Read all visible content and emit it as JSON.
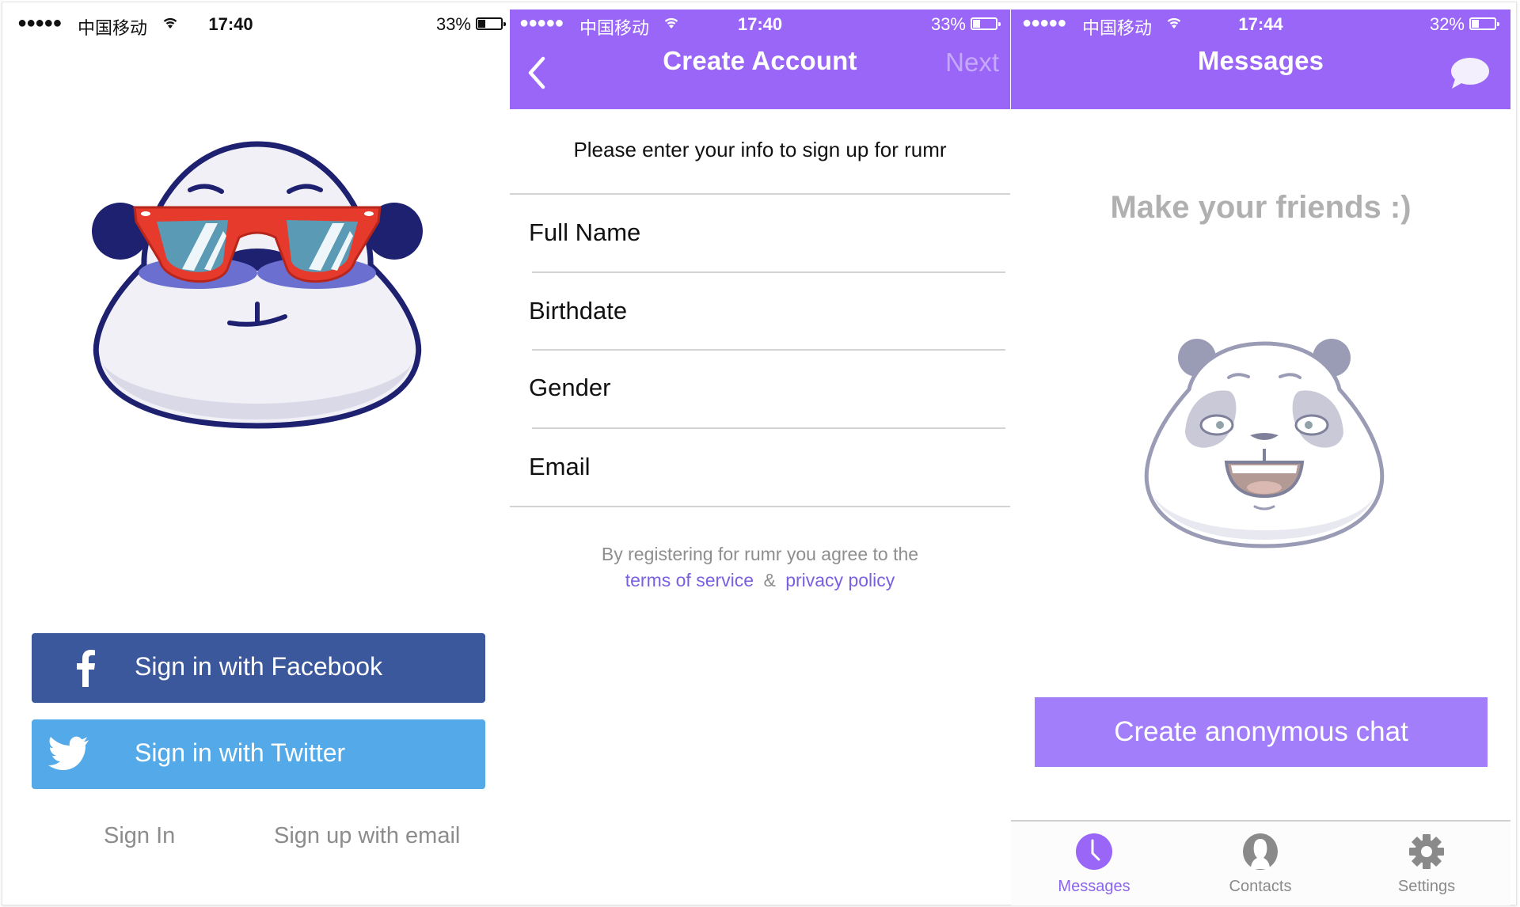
{
  "colors": {
    "brand_purple": "#9966f7",
    "button_purple": "#a27efa",
    "facebook_blue": "#3a589b",
    "twitter_blue": "#54aae9",
    "link_purple": "#7a5fe0",
    "muted_grey": "#8c8c8c"
  },
  "screens": [
    {
      "status": {
        "signal": "●●●●●",
        "carrier": "中国移动",
        "time": "17:40",
        "battery": "33%",
        "battery_level": 0.33
      },
      "buttons": {
        "facebook": {
          "label": "Sign in with Facebook",
          "icon": "facebook-icon"
        },
        "twitter": {
          "label": "Sign in with Twitter",
          "icon": "twitter-icon"
        }
      },
      "links": {
        "sign_in": "Sign In",
        "sign_up_email": "Sign up with email"
      },
      "illustration": "panda-sunglasses"
    },
    {
      "status": {
        "signal": "●●●●●",
        "carrier": "中国移动",
        "time": "17:40",
        "battery": "33%",
        "battery_level": 0.33
      },
      "nav": {
        "title": "Create Account",
        "back_icon": "chevron-left-icon",
        "next_label": "Next"
      },
      "subtitle": "Please enter your info to sign up for rumr",
      "fields": [
        {
          "label": "Full Name"
        },
        {
          "label": "Birthdate"
        },
        {
          "label": "Gender"
        },
        {
          "label": "Email"
        }
      ],
      "legal": {
        "line1": "By registering for rumr you agree to the",
        "terms": "terms of service",
        "amp": "&",
        "privacy": "privacy policy"
      }
    },
    {
      "status": {
        "signal": "●●●●●",
        "carrier": "中国移动",
        "time": "17:44",
        "battery": "32%",
        "battery_level": 0.32
      },
      "nav": {
        "title": "Messages",
        "action_icon": "chat-bubble-icon"
      },
      "empty_text": "Make your friends :)",
      "illustration": "panda-happy",
      "cta": "Create anonymous chat",
      "tabs": [
        {
          "label": "Messages",
          "icon": "clock-icon",
          "active": true
        },
        {
          "label": "Contacts",
          "icon": "person-icon",
          "active": false
        },
        {
          "label": "Settings",
          "icon": "gear-icon",
          "active": false
        }
      ]
    }
  ]
}
